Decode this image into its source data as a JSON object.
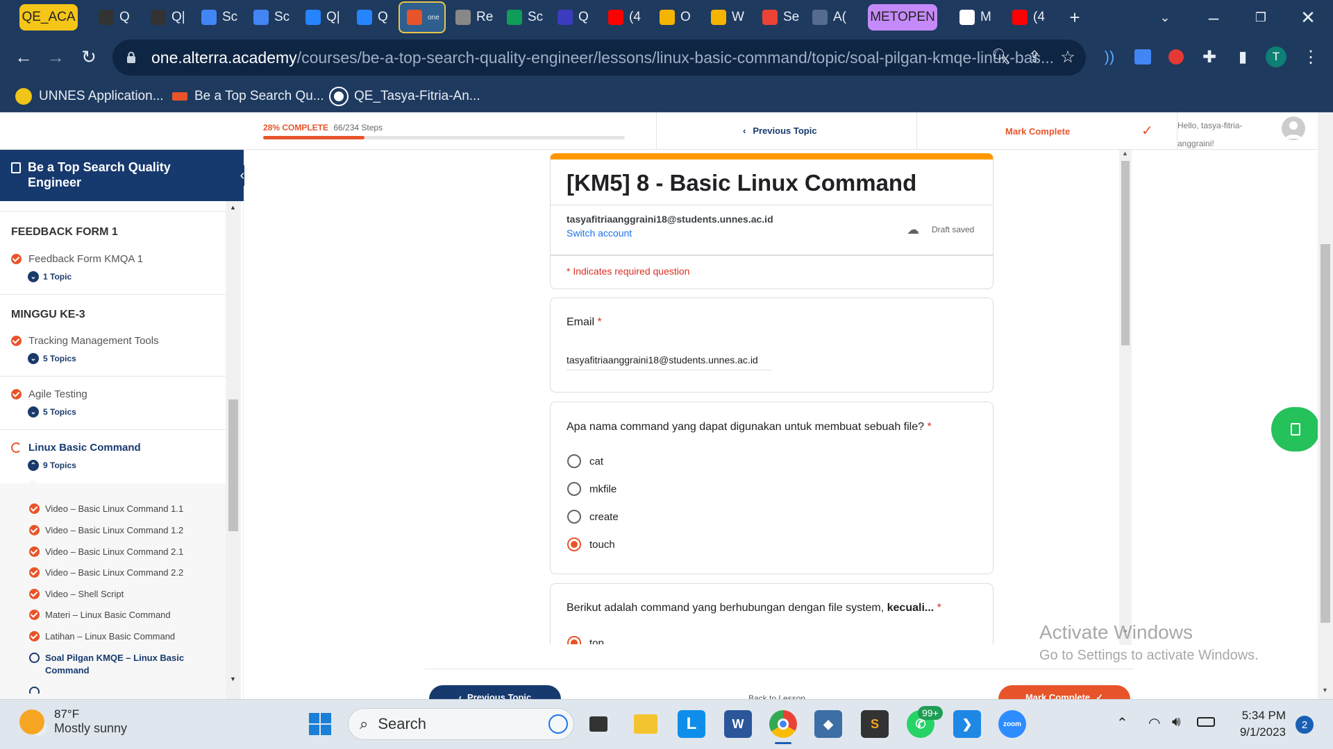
{
  "browser": {
    "tabs": [
      {
        "label": "QE_ACA",
        "color": "#f5c518"
      },
      {
        "label": "Q",
        "color": "#333333"
      },
      {
        "label": "Q|",
        "color": "#333333"
      },
      {
        "label": "Sc",
        "color": "#4285f4"
      },
      {
        "label": "Sc",
        "color": "#4285f4"
      },
      {
        "label": "Q|",
        "color": "#2684ff"
      },
      {
        "label": "Q",
        "color": "#2684ff"
      },
      {
        "label": "one",
        "color": "#e8542a"
      },
      {
        "label": "Re",
        "color": "#888888"
      },
      {
        "label": "Sc",
        "color": "#0f9d58"
      },
      {
        "label": "Q",
        "color": "#3b3bbf"
      },
      {
        "label": "(4",
        "color": "#ff0000"
      },
      {
        "label": "O",
        "color": "#f4b400"
      },
      {
        "label": "W",
        "color": "#f4b400"
      },
      {
        "label": "Se",
        "color": "#ea4335"
      },
      {
        "label": "A(",
        "color": "#556b8f"
      },
      {
        "label": "METOPEN",
        "color": "#c58af9"
      },
      {
        "label": "M",
        "color": "#ffffff"
      },
      {
        "label": "(4",
        "color": "#ff0000"
      }
    ],
    "new_tab": "+",
    "url_domain": "one.alterra.academy",
    "url_path": "/courses/be-a-top-search-quality-engineer/lessons/linux-basic-command/topic/soal-pilgan-kmqe-linux-bas...",
    "profile_initial": "T",
    "bookmarks": [
      "UNNES Application...",
      "Be a Top Search Qu...",
      "QE_Tasya-Fitria-An..."
    ]
  },
  "lms": {
    "progress_percent": 28,
    "progress_label": "28% COMPLETE",
    "steps_label": "66/234 Steps",
    "previous_topic": "Previous Topic",
    "mark_complete": "Mark Complete",
    "greeting_1": "Hello, tasya-fitria-",
    "greeting_2": "anggraini!",
    "course_title": "Be a Top Search Quality Engineer",
    "sections": [
      {
        "title": "FEEDBACK FORM 1"
      },
      {
        "title": "MINGGU KE-3"
      }
    ],
    "lessons": [
      {
        "label": "Feedback Form KMQA 1",
        "topics": "1 Topic"
      },
      {
        "label": "Tracking Management Tools",
        "topics": "5 Topics"
      },
      {
        "label": "Agile Testing",
        "topics": "5 Topics"
      },
      {
        "label": "Linux Basic Command",
        "topics": "9 Topics"
      }
    ],
    "subtopics": [
      "Video – Basic Linux Command 1.1",
      "Video – Basic Linux Command 1.2",
      "Video – Basic Linux Command 2.1",
      "Video – Basic Linux Command 2.2",
      "Video – Shell Script",
      "Materi – Linux Basic Command",
      "Latihan – Linux Basic Command",
      "Soal Pilgan KMQE – Linux Basic Command"
    ],
    "bottom_prev": "Previous Topic",
    "bottom_back": "Back to Lesson",
    "bottom_mark": "Mark Complete"
  },
  "form": {
    "title": "[KM5] 8 - Basic Linux Command",
    "account_email": "tasyafitriaanggraini18@students.unnes.ac.id",
    "switch_account": "Switch account",
    "draft_status": "Draft saved",
    "required_note": "* Indicates required question",
    "email_label": "Email",
    "email_value": "tasyafitriaanggraini18@students.unnes.ac.id",
    "q1": "Apa nama command yang dapat digunakan untuk membuat sebuah file?",
    "q1_options": [
      "cat",
      "mkfile",
      "create",
      "touch"
    ],
    "q1_selected": "touch",
    "q2_prefix": "Berikut adalah command yang berhubungan dengan file system, ",
    "q2_bold": "kecuali...",
    "q2_first_option": "top",
    "required_mark": "*"
  },
  "watermark": {
    "line1": "Activate Windows",
    "line2": "Go to Settings to activate Windows."
  },
  "taskbar": {
    "weather_temp": "87°F",
    "weather_desc": "Mostly sunny",
    "search_placeholder": "Search",
    "whatsapp_badge": "99+",
    "zoom_label": "zoom",
    "time": "5:34 PM",
    "date": "9/1/2023",
    "notification_count": "2"
  },
  "colors": {
    "accent": "#e8542a",
    "navy": "#173a6e",
    "chrome": "#1f3a5f",
    "form_accent": "#ff9800"
  }
}
